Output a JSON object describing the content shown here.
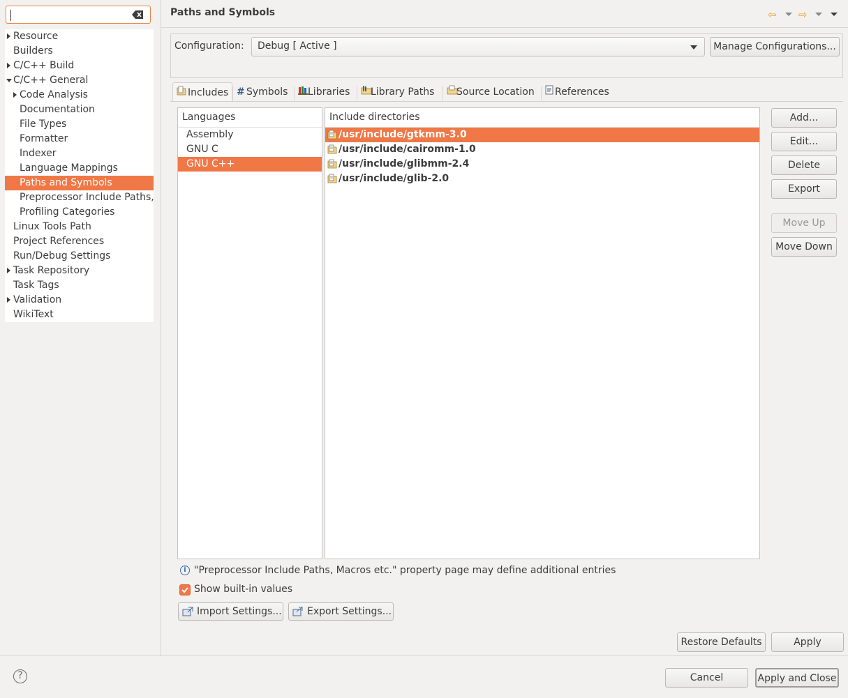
{
  "filter": {
    "value": ""
  },
  "tree": {
    "items": [
      {
        "label": "Resource",
        "arrow": "collapsed",
        "indent": 0
      },
      {
        "label": "Builders",
        "arrow": "none",
        "indent": 0
      },
      {
        "label": "C/C++ Build",
        "arrow": "collapsed",
        "indent": 0
      },
      {
        "label": "C/C++ General",
        "arrow": "expanded",
        "indent": 0
      },
      {
        "label": "Code Analysis",
        "arrow": "collapsed",
        "indent": 1
      },
      {
        "label": "Documentation",
        "arrow": "none",
        "indent": 1
      },
      {
        "label": "File Types",
        "arrow": "none",
        "indent": 1
      },
      {
        "label": "Formatter",
        "arrow": "none",
        "indent": 1
      },
      {
        "label": "Indexer",
        "arrow": "none",
        "indent": 1
      },
      {
        "label": "Language Mappings",
        "arrow": "none",
        "indent": 1
      },
      {
        "label": "Paths and Symbols",
        "arrow": "none",
        "indent": 1,
        "selected": true
      },
      {
        "label": "Preprocessor Include Paths,",
        "arrow": "none",
        "indent": 1
      },
      {
        "label": "Profiling Categories",
        "arrow": "none",
        "indent": 1
      },
      {
        "label": "Linux Tools Path",
        "arrow": "none",
        "indent": 0
      },
      {
        "label": "Project References",
        "arrow": "none",
        "indent": 0
      },
      {
        "label": "Run/Debug Settings",
        "arrow": "none",
        "indent": 0
      },
      {
        "label": "Task Repository",
        "arrow": "collapsed",
        "indent": 0
      },
      {
        "label": "Task Tags",
        "arrow": "none",
        "indent": 0
      },
      {
        "label": "Validation",
        "arrow": "collapsed",
        "indent": 0
      },
      {
        "label": "WikiText",
        "arrow": "none",
        "indent": 0
      }
    ]
  },
  "header": {
    "title": "Paths and Symbols"
  },
  "config": {
    "label": "Configuration:",
    "value": "Debug  [ Active ]",
    "manage_label": "Manage Configurations..."
  },
  "tabs": [
    {
      "label": "Includes",
      "icon": "includes-icon",
      "active": true
    },
    {
      "label": "Symbols",
      "icon": "hash-icon"
    },
    {
      "label": "Libraries",
      "icon": "libraries-icon"
    },
    {
      "label": "Library Paths",
      "icon": "library-paths-icon"
    },
    {
      "label": "Source Location",
      "icon": "source-folder-icon"
    },
    {
      "label": "References",
      "icon": "references-icon"
    }
  ],
  "languages": {
    "header": "Languages",
    "items": [
      "Assembly",
      "GNU C",
      "GNU C++"
    ],
    "selected": "GNU C++"
  },
  "includes": {
    "header": "Include directories",
    "items": [
      "/usr/include/gtkmm-3.0",
      "/usr/include/cairomm-1.0",
      "/usr/include/glibmm-2.4",
      "/usr/include/glib-2.0"
    ],
    "selected": "/usr/include/gtkmm-3.0"
  },
  "side_buttons": {
    "add": "Add...",
    "edit": "Edit...",
    "delete": "Delete",
    "export": "Export",
    "move_up": "Move Up",
    "move_down": "Move Down"
  },
  "info_text": "\"Preprocessor Include Paths, Macros etc.\" property page may define additional entries",
  "show_builtin": {
    "label": "Show built-in values",
    "checked": true
  },
  "import_settings": "Import Settings...",
  "export_settings": "Export Settings...",
  "restore_defaults": "Restore Defaults",
  "apply": "Apply",
  "cancel": "Cancel",
  "apply_close": "Apply and Close",
  "colors": {
    "accent": "#f07746",
    "background": "#f2f1f0"
  }
}
